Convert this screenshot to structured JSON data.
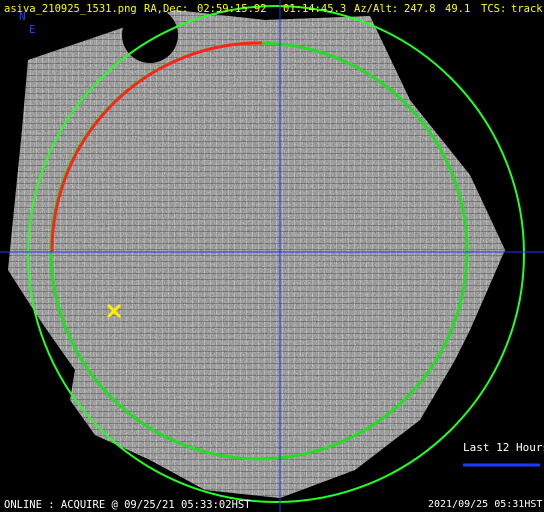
{
  "header": {
    "filename": "asiva_210925_1531.png",
    "radec_label": "RA,Dec:",
    "ra": "02:59:15.92",
    "dec": "01:14:45.3",
    "azalt_label": "Az/Alt:",
    "az": "247.8",
    "alt": "49.1",
    "tcs_label": "TCS:",
    "tcs_mode": "track"
  },
  "compass": {
    "north": "N",
    "east": "E"
  },
  "legend": {
    "label": "Last 12 Hours"
  },
  "footer": {
    "status": "ONLINE : ACQUIRE @ 09/25/21 05:33:02HST",
    "timestamp": "2021/09/25 05:31HST"
  },
  "colors": {
    "text_yellow": "#ffff00",
    "text_white": "#ffffff",
    "crosshair_blue": "#2233ff",
    "horizon_circle_green": "#22ff22",
    "inner_circle_green": "#22dd22",
    "track_arc_red": "#ff2020",
    "target_marker_yellow": "#ffee00",
    "legend_line_blue": "#1a3cff"
  },
  "icons": {
    "target": "x-mark-icon"
  }
}
